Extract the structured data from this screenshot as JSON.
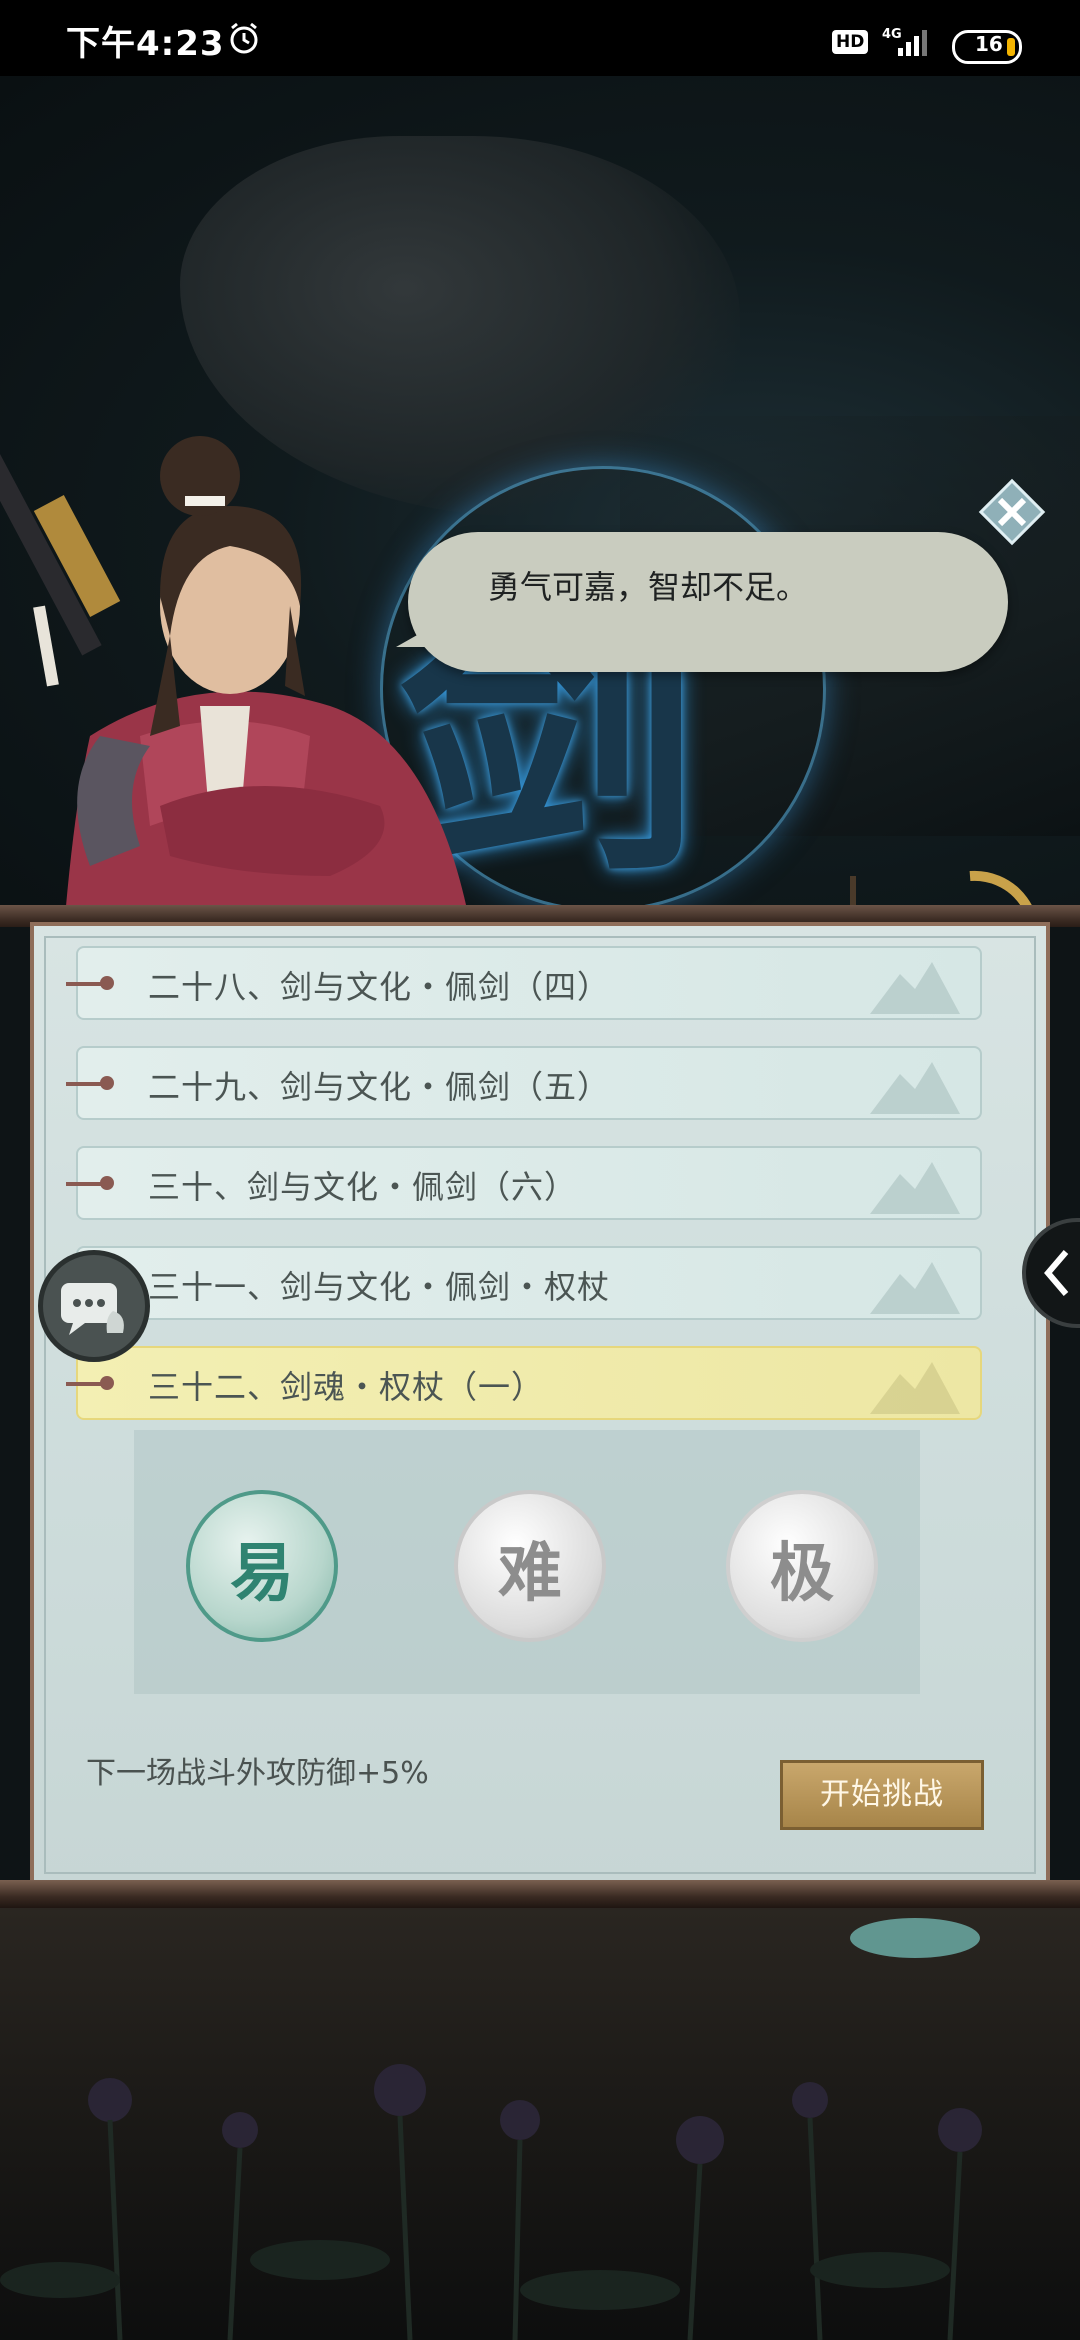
{
  "status_bar": {
    "time": "下午4:23",
    "network_badge": "HD",
    "network_type": "4G",
    "battery_level": "16"
  },
  "dialog": {
    "speech": "勇气可嘉，智却不足。",
    "close_icon": "close-icon"
  },
  "chapters": [
    {
      "label": "二十八、剑与文化・佩剑（四）",
      "active": false
    },
    {
      "label": "二十九、剑与文化・佩剑（五）",
      "active": false
    },
    {
      "label": "三十、剑与文化・佩剑（六）",
      "active": false
    },
    {
      "label": "三十一、剑与文化・佩剑・权杖",
      "active": false
    },
    {
      "label": "三十二、剑魂・权杖（一）",
      "active": true
    }
  ],
  "difficulty": {
    "easy": "易",
    "hard": "难",
    "extreme": "极",
    "selected": "易"
  },
  "bonus_text": "下一场战斗外攻防御+5%",
  "start_button": "开始挑战",
  "colors": {
    "accent_active": "#ede7a4",
    "button_gold": "#b8965a",
    "panel_bg": "#d3e1e0"
  }
}
